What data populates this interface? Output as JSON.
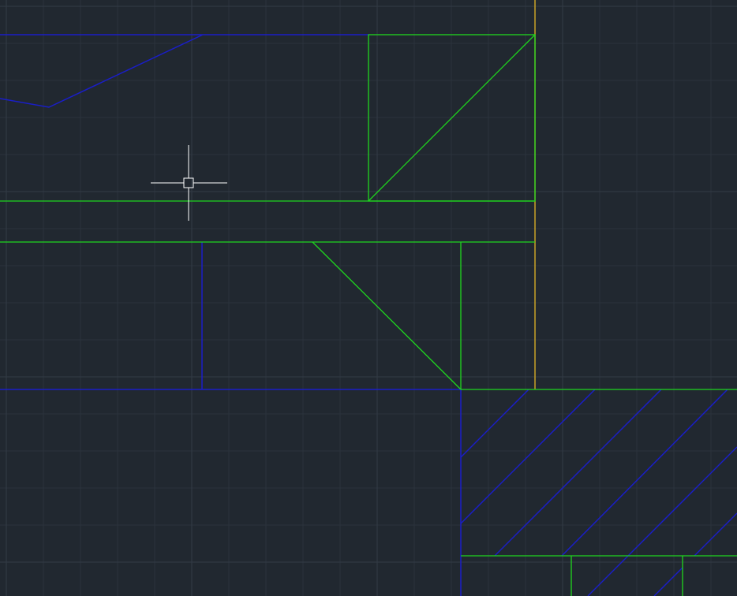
{
  "app": {
    "view": "cad-model-space"
  },
  "colors": {
    "background": "#212830",
    "grid_minor": "#2a323c",
    "grid_major": "#323b46",
    "layer_green": "#1fd61f",
    "layer_blue": "#1a1ec8",
    "layer_yellow": "#c9a227",
    "cursor": "#ffffff"
  },
  "icons": {
    "cursor": "crosshair-pickbox-icon"
  }
}
